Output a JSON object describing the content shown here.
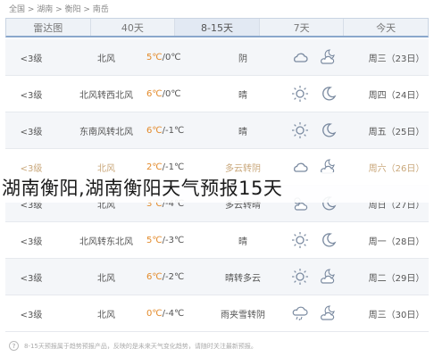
{
  "breadcrumb": "全国 > 湖南 > 衡阳 > 南岳",
  "tabs": [
    {
      "label": "雷达图"
    },
    {
      "label": "40天",
      "badge": "hot"
    },
    {
      "label": "8-15天"
    },
    {
      "label": "7天"
    },
    {
      "label": "今天"
    }
  ],
  "rows": [
    {
      "date": "周三（23日）",
      "condition": "阴",
      "temp_high": "5℃",
      "temp_low": "0℃",
      "wind": "北风",
      "level": "<3级",
      "icon1": "cloud-icon",
      "icon2": "cloud-moon-icon"
    },
    {
      "date": "周四（24日）",
      "condition": "晴",
      "temp_high": "6℃",
      "temp_low": "0℃",
      "wind": "北风转西北风",
      "level": "<3级",
      "icon1": "sun-icon",
      "icon2": "moon-icon"
    },
    {
      "date": "周五（25日）",
      "condition": "晴",
      "temp_high": "6℃",
      "temp_low": "-1℃",
      "wind": "东南风转北风",
      "level": "<3级",
      "icon1": "sun-icon",
      "icon2": "moon-icon"
    },
    {
      "date": "周六（26日）",
      "condition": "多云转阴",
      "temp_high": "2℃",
      "temp_low": "-1℃",
      "wind": "北风",
      "level": "<3级",
      "icon1": "cloud-icon",
      "icon2": "cloud-moon-icon"
    },
    {
      "date": "周日（27日）",
      "condition": "多云转晴",
      "temp_high": "3℃",
      "temp_low": "-4℃",
      "wind": "北风",
      "level": "<3级",
      "icon1": "sun-cloud-icon",
      "icon2": "moon-icon"
    },
    {
      "date": "周一（28日）",
      "condition": "晴",
      "temp_high": "5℃",
      "temp_low": "-3℃",
      "wind": "北风转东北风",
      "level": "<3级",
      "icon1": "sun-icon",
      "icon2": "moon-icon"
    },
    {
      "date": "周二（29日）",
      "condition": "晴转多云",
      "temp_high": "6℃",
      "temp_low": "-2℃",
      "wind": "北风",
      "level": "<3级",
      "icon1": "sun-icon",
      "icon2": "cloud-moon-icon"
    },
    {
      "date": "周三（30日）",
      "condition": "雨夹雪转阴",
      "temp_high": "0℃",
      "temp_low": "-4℃",
      "wind": "北风",
      "level": "<3级",
      "icon1": "sleet-icon",
      "icon2": "cloud-moon-icon"
    }
  ],
  "overlay_title": "湖南衡阳,湖南衡阳天气预报15天",
  "footer_note": "8-15天预报属于趋势预报产品，反映的是未来天气变化趋势，请随时关注最新预报。",
  "colors": {
    "high_temp": "#e38a2a",
    "tab_bg": "#eef2f7",
    "row_alt": "#f4f6f9"
  }
}
